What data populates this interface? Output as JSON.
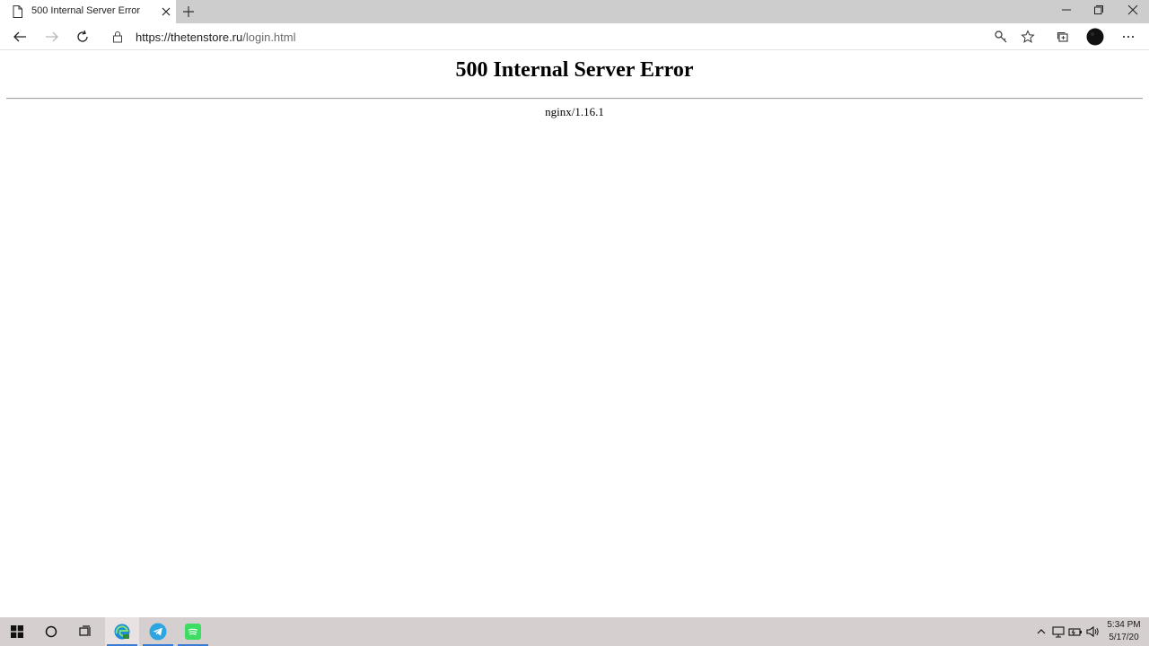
{
  "browser": {
    "tab": {
      "title": "500 Internal Server Error"
    },
    "address": {
      "host": "https://thetenstore.ru",
      "path": "/login.html"
    }
  },
  "page": {
    "heading": "500 Internal Server Error",
    "server": "nginx/1.16.1"
  },
  "taskbar": {
    "clock": {
      "time": "5:34 PM",
      "date": "5/17/20"
    }
  },
  "colors": {
    "titlebar": "#cdcdcd",
    "taskbar": "#d6cfcf",
    "telegram": "#2ca5e0",
    "spotify": "#3ddc63",
    "edge_accent": "#3a7bd5"
  },
  "icons": [
    "page-icon",
    "close-icon",
    "plus-icon",
    "minimize-icon",
    "restore-icon",
    "back-arrow-icon",
    "forward-arrow-icon",
    "reload-icon",
    "lock-icon",
    "key-icon",
    "star-icon",
    "collections-icon",
    "profile-avatar",
    "more-icon",
    "windows-logo-icon",
    "search-circle-icon",
    "task-view-icon",
    "edge-icon",
    "telegram-icon",
    "spotify-icon",
    "chevron-up-icon",
    "network-icon",
    "battery-icon",
    "volume-icon"
  ]
}
